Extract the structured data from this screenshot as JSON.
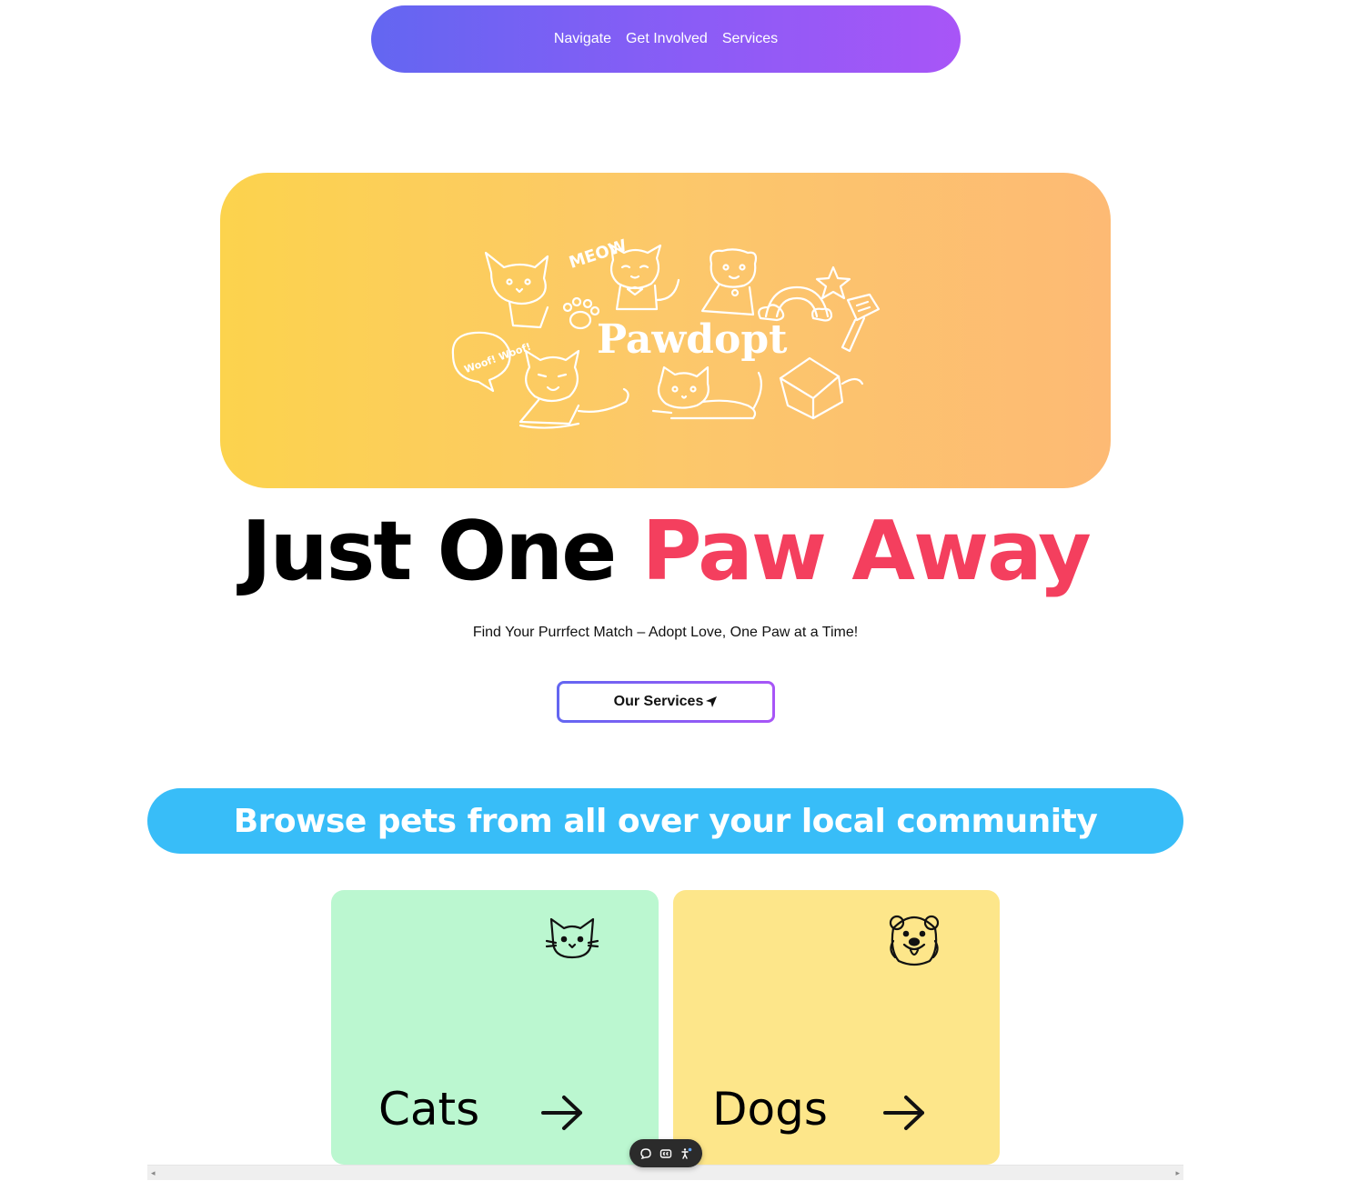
{
  "nav": {
    "items": [
      "Navigate",
      "Get Involved",
      "Services"
    ]
  },
  "hero": {
    "logo_text": "Pawdopt",
    "meow_text": "MEOW",
    "woof_text": "Woof! Woof!"
  },
  "headline": {
    "part1": "Just One ",
    "part2": "Paw Away"
  },
  "tagline": "Find Your Purrfect Match – Adopt Love, One Paw at a Time!",
  "cta": {
    "label": "Our Services"
  },
  "banner": {
    "text": "Browse pets from all over your local community"
  },
  "cards": [
    {
      "label": "Cats",
      "icon": "cat-icon",
      "color": "#bbf7d0"
    },
    {
      "label": "Dogs",
      "icon": "dog-icon",
      "color": "#fde68a"
    }
  ],
  "colors": {
    "nav_gradient_start": "#6366f1",
    "nav_gradient_end": "#a855f7",
    "accent": "#f43f5e",
    "banner": "#38bdf8",
    "hero_gradient_start": "#fcd34d",
    "hero_gradient_end": "#fdba74"
  },
  "toolbar": {
    "icons": [
      "comment-icon",
      "caption-icon",
      "accessibility-icon"
    ]
  }
}
